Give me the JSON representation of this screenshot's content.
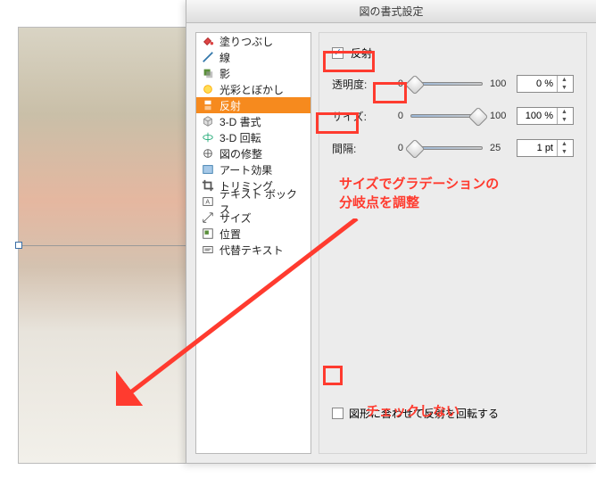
{
  "dialog": {
    "title": "図の書式設定"
  },
  "categories": [
    {
      "label": "塗りつぶし"
    },
    {
      "label": "線"
    },
    {
      "label": "影"
    },
    {
      "label": "光彩とぼかし"
    },
    {
      "label": "反射"
    },
    {
      "label": "3-D 書式"
    },
    {
      "label": "3-D 回転"
    },
    {
      "label": "図の修整"
    },
    {
      "label": "アート効果"
    },
    {
      "label": "トリミング"
    },
    {
      "label": "テキスト ボックス"
    },
    {
      "label": "サイズ"
    },
    {
      "label": "位置"
    },
    {
      "label": "代替テキスト"
    }
  ],
  "content": {
    "reflect_label": "反射",
    "transparency_label": "透明度:",
    "transparency_min": "0",
    "transparency_max": "100",
    "transparency_value": "0 %",
    "size_label": "サイズ:",
    "size_min": "0",
    "size_max": "100",
    "size_value": "100 %",
    "gap_label": "間隔:",
    "gap_min": "0",
    "gap_max": "25",
    "gap_value": "1 pt",
    "rotate_label": "図形に合わせて反射を回転する"
  },
  "annotations": {
    "note1_line1": "サイズでグラデーションの",
    "note1_line2": "分岐点を調整",
    "note2": "チェックしない"
  }
}
